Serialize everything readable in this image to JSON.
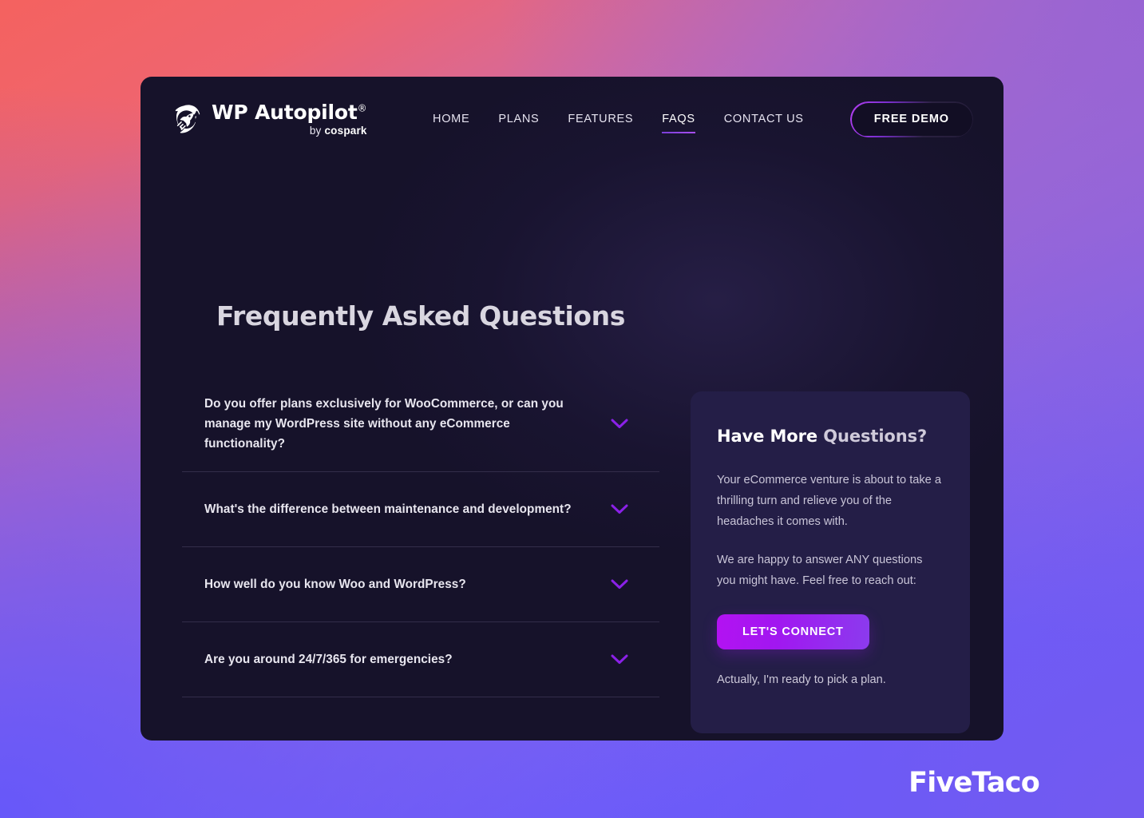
{
  "background": {
    "gradient_from": "#f4625f",
    "gradient_mid": "#9764d4",
    "gradient_to": "#6457fb"
  },
  "brand": {
    "icon": "rocket-icon",
    "name": "WP Autopilot",
    "registered_mark": "®",
    "tagline_prefix": "by ",
    "tagline_bold": "co",
    "tagline_rest": "spark",
    "tagline_full": "by cospark"
  },
  "nav": {
    "items": [
      {
        "label": "HOME",
        "active": false
      },
      {
        "label": "PLANS",
        "active": false
      },
      {
        "label": "FEATURES",
        "active": false
      },
      {
        "label": "FAQS",
        "active": true
      },
      {
        "label": "CONTACT US",
        "active": false
      }
    ],
    "cta": {
      "label": "FREE DEMO",
      "border_color": "#b23ff0"
    }
  },
  "main": {
    "title": "Frequently Asked Questions",
    "accordion_icon": "chevron-down-icon",
    "accordion_icon_color": "#8b21e8",
    "faqs": [
      {
        "question": "Do you offer plans exclusively for WooCommerce, or can you manage my WordPress site without any eCommerce functionality?",
        "expanded": false
      },
      {
        "question": "What's the difference between maintenance and development?",
        "expanded": false
      },
      {
        "question": "How well do you know Woo and WordPress?",
        "expanded": false
      },
      {
        "question": "Are you around 24/7/365 for emergencies?",
        "expanded": false
      }
    ]
  },
  "side_card": {
    "title_part1": "Have More ",
    "title_part2": "Questions?",
    "paragraph1": "Your eCommerce venture is about to take a thrilling turn and relieve you of the headaches it comes with.",
    "paragraph2": "We are happy to answer ANY questions you might have. Feel free to reach out:",
    "button_label": "LET'S CONNECT",
    "button_color": "#b312f2",
    "link_label": "Actually, I'm ready to pick a plan.",
    "background_color": "#241e47"
  },
  "watermark": {
    "label": "FiveTaco"
  }
}
